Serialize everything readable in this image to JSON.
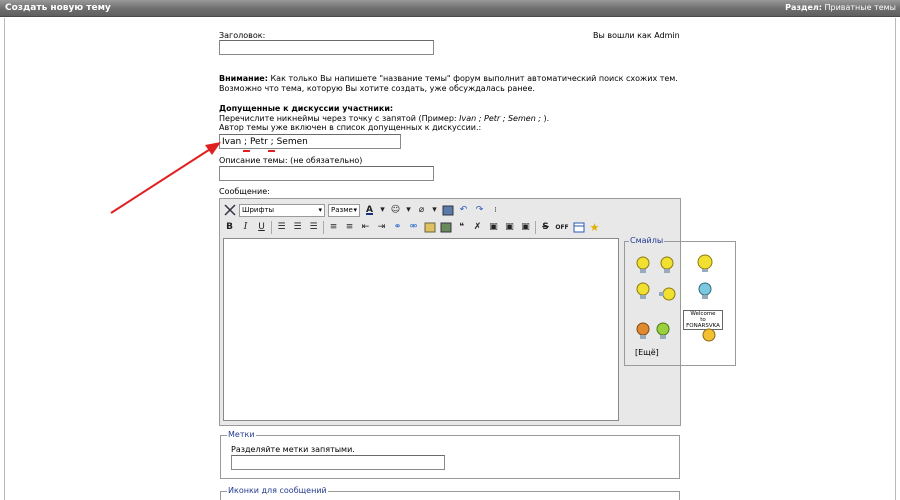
{
  "header": {
    "title": "Создать новую тему",
    "section_label": "Раздел:",
    "section_value": "Приватные темы"
  },
  "form": {
    "subject_label": "Заголовок:",
    "logged_in": "Вы вошли как Admin",
    "warning_bold": "Внимание:",
    "warning_text": " Как только Вы напишете \"название темы\" форум выполнит автоматический поиск схожих тем.",
    "warning_line2": "Возможно что тема, которую Вы хотите создать, уже обсуждалась ранее.",
    "participants_title": "Допущенные к дискуссии участники:",
    "participants_hint_prefix": "Перечислите никнеймы через точку с запятой (Пример: ",
    "participants_hint_example": "Ivan ; Petr ; Semen ;",
    "participants_hint_suffix": " ).",
    "participants_hint2": "Автор темы уже включен в список допущенных к дискуссии.:",
    "participants_value": "Ivan ; Petr ; Semen",
    "description_label": "Описание темы: (не обязательно)",
    "message_label": "Сообщение:"
  },
  "toolbar": {
    "font_select": "Шрифты",
    "size_select": "Разме",
    "off_label": "OFF"
  },
  "smileys": {
    "legend": "Смайлы",
    "welcome_line1": "Welcome",
    "welcome_line2": "to",
    "welcome_line3": "FONARSVKA",
    "more_link": "[Ещё]"
  },
  "tags": {
    "legend": "Метки",
    "hint": "Разделяйте метки запятыми."
  },
  "icons_section": {
    "legend": "Иконки для сообщений"
  },
  "colors": {
    "arrow": "#e02020",
    "accent": "#223b8f"
  }
}
